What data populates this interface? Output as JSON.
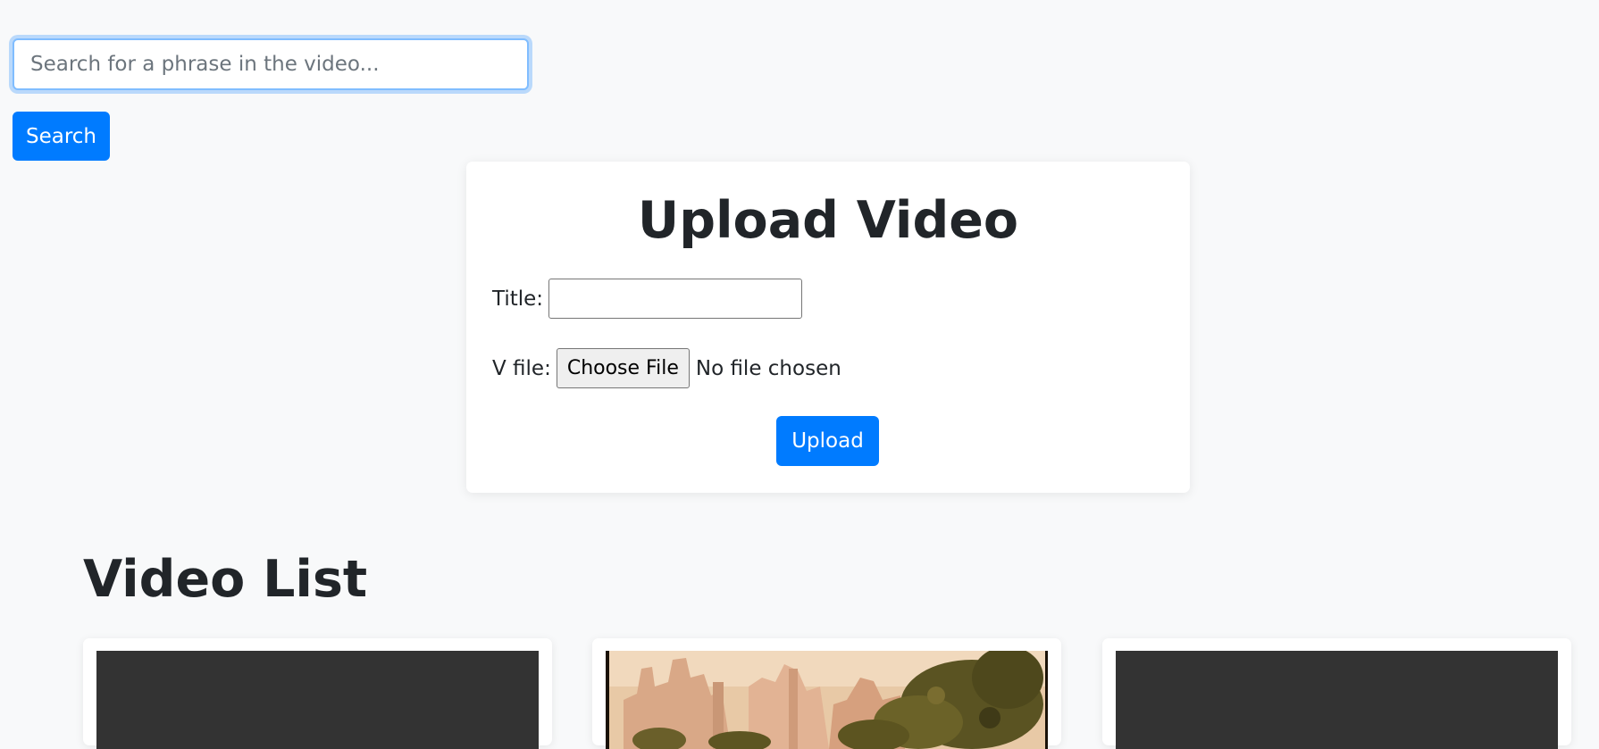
{
  "search": {
    "placeholder": "Search for a phrase in the video...",
    "value": "",
    "button_label": "Search"
  },
  "upload": {
    "heading": "Upload Video",
    "title_label": "Title:",
    "title_value": "",
    "file_label": "V file:",
    "choose_file_label": "Choose File",
    "file_status": "No file chosen",
    "button_label": "Upload"
  },
  "video_list": {
    "heading": "Video List",
    "videos": [
      {
        "thumbnail": "blank"
      },
      {
        "thumbnail": "painting"
      },
      {
        "thumbnail": "blank"
      }
    ]
  },
  "colors": {
    "primary": "#007bff",
    "background": "#f8f9fa",
    "thumb_dark": "#333333"
  }
}
